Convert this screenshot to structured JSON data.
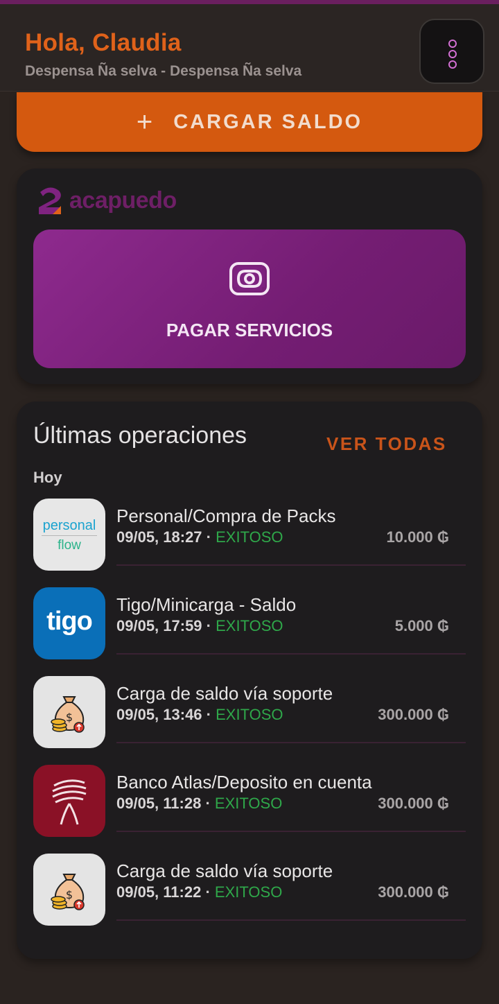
{
  "header": {
    "greeting": "Hola, Claudia",
    "store": "Despensa Ña selva - Despensa Ña selva",
    "menu_icon": "more-vertical-icon"
  },
  "actions": {
    "cargar_plus": "+",
    "cargar_label": "CARGAR SALDO",
    "brand_name": "acapuedo",
    "pagar_icon": "scan-camera-icon",
    "pagar_label": "PAGAR SERVICIOS"
  },
  "operations": {
    "title": "Últimas operaciones",
    "view_all": "VER TODAS",
    "group_label": "Hoy",
    "items": [
      {
        "title": "Personal/Compra de Packs",
        "datetime": "09/05, 18:27",
        "separator": "·",
        "status": "EXITOSO",
        "amount": "10.000 ₲",
        "logo": "personal-flow-logo",
        "logo_text_top": "personal",
        "logo_text_bottom": "flow"
      },
      {
        "title": "Tigo/Minicarga - Saldo",
        "datetime": "09/05, 17:59",
        "separator": "·",
        "status": "EXITOSO",
        "amount": "5.000 ₲",
        "logo": "tigo-logo",
        "logo_text": "tigo"
      },
      {
        "title": "Carga de saldo vía soporte",
        "datetime": "09/05, 13:46",
        "separator": "·",
        "status": "EXITOSO",
        "amount": "300.000 ₲",
        "logo": "money-bag-icon"
      },
      {
        "title": "Banco Atlas/Deposito en cuenta",
        "datetime": "09/05, 11:28",
        "separator": "·",
        "status": "EXITOSO",
        "amount": "300.000 ₲",
        "logo": "banco-atlas-logo"
      },
      {
        "title": "Carga de saldo vía soporte",
        "datetime": "09/05, 11:22",
        "separator": "·",
        "status": "EXITOSO",
        "amount": "300.000 ₲",
        "logo": "money-bag-icon"
      }
    ]
  },
  "colors": {
    "accent_orange": "#d4590f",
    "brand_purple": "#7f2380",
    "success_green": "#2fa84a",
    "background": "#2a2320"
  }
}
